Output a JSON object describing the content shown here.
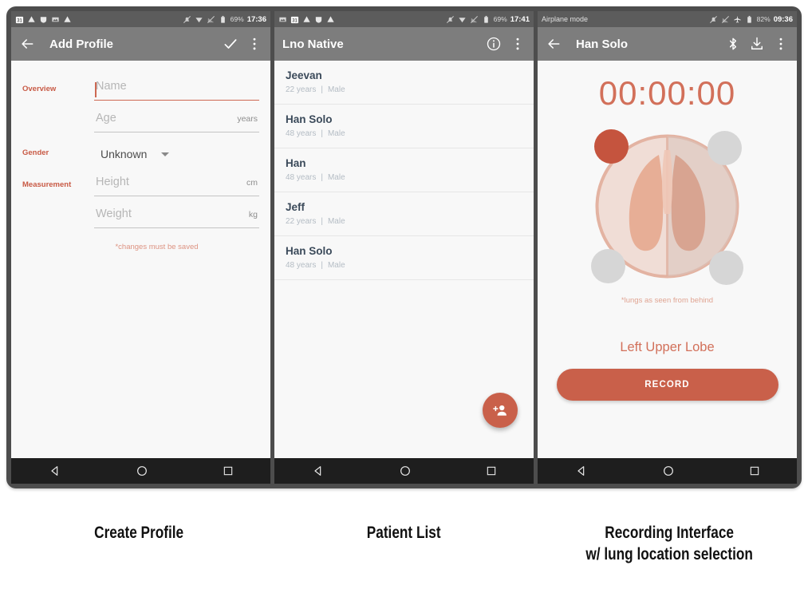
{
  "phones": [
    {
      "id": "create-profile",
      "statusbar": {
        "left_icons": [
          "calendar-icon",
          "drive-icon",
          "shield-icon",
          "image-icon",
          "drive-icon"
        ],
        "right_icons": [
          "bell-muted-icon",
          "wifi-icon",
          "signal-off-icon",
          "battery-icon"
        ],
        "battery": "69%",
        "time": "17:36",
        "label": ""
      },
      "appbar": {
        "back_icon": "arrow-back-icon",
        "title": "Add Profile",
        "actions": [
          "check-icon",
          "overflow-icon"
        ]
      },
      "form": {
        "rows": [
          {
            "label": "Overview",
            "placeholder": "Name",
            "unit": "",
            "focused": true
          },
          {
            "label": "",
            "placeholder": "Age",
            "unit": "years",
            "focused": false
          },
          {
            "label": "Gender",
            "select_value": "Unknown"
          },
          {
            "label": "Measurement",
            "placeholder": "Height",
            "unit": "cm",
            "focused": false
          },
          {
            "label": "",
            "placeholder": "Weight",
            "unit": "kg",
            "focused": false
          }
        ],
        "note": "*changes must be saved"
      }
    },
    {
      "id": "patient-list",
      "statusbar": {
        "battery": "69%",
        "time": "17:41",
        "label": ""
      },
      "appbar": {
        "title": "Lno Native",
        "actions": [
          "info-icon",
          "overflow-icon"
        ]
      },
      "patients": [
        {
          "name": "Jeevan",
          "age": "22 years",
          "gender": "Male"
        },
        {
          "name": "Han Solo",
          "age": "48 years",
          "gender": "Male"
        },
        {
          "name": "Han",
          "age": "48 years",
          "gender": "Male"
        },
        {
          "name": "Jeff",
          "age": "22 years",
          "gender": "Male"
        },
        {
          "name": "Han Solo",
          "age": "48 years",
          "gender": "Male"
        }
      ],
      "fab": {
        "icon": "person-add-icon"
      }
    },
    {
      "id": "recording-interface",
      "statusbar": {
        "label": "Airplane mode",
        "battery": "82%",
        "time": "09:36"
      },
      "appbar": {
        "back_icon": "arrow-back-icon",
        "title": "Han Solo",
        "actions": [
          "bluetooth-icon",
          "download-icon",
          "overflow-icon"
        ]
      },
      "recorder": {
        "timer": "00:00:00",
        "lung_note": "*lungs as seen from behind",
        "selected_lobe": "Left Upper Lobe",
        "record_label": "RECORD",
        "dots": [
          {
            "position": "top-left",
            "selected": true
          },
          {
            "position": "top-right",
            "selected": false
          },
          {
            "position": "bottom-left",
            "selected": false
          },
          {
            "position": "bottom-right",
            "selected": false
          }
        ]
      }
    }
  ],
  "navbar": {
    "back_icon": "triangle-back-icon",
    "home_icon": "circle-home-icon",
    "recents_icon": "square-recents-icon"
  },
  "captions": [
    "Create Profile",
    "Patient List",
    "Recording Interface\nw/ lung location selection"
  ],
  "colors": {
    "accent": "#c9604a",
    "accent_light": "#d2705a",
    "label": "#c85a45",
    "frame": "#4d4d4d",
    "appbar": "#7d7d7d",
    "statusbar": "#5c5c5c",
    "navbar": "#1e1e1e",
    "name_text": "#3b4a5a",
    "meta_text": "#b4bcc4",
    "dot_unselected": "#d6d6d6",
    "dot_selected": "#c5543e"
  }
}
